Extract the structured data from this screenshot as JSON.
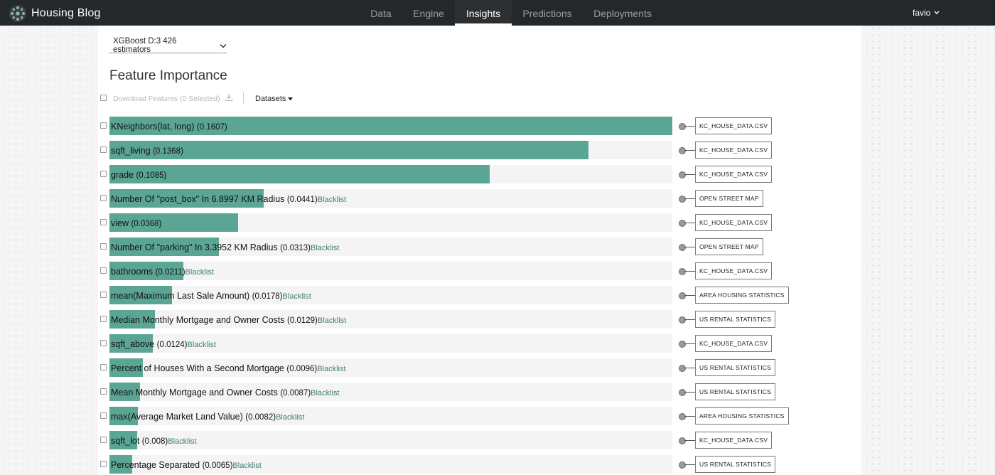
{
  "app": {
    "name": "Housing Blog",
    "user": "favio"
  },
  "nav": {
    "tabs": [
      {
        "label": "Data",
        "active": false
      },
      {
        "label": "Engine",
        "active": false
      },
      {
        "label": "Insights",
        "active": true
      },
      {
        "label": "Predictions",
        "active": false
      },
      {
        "label": "Deployments",
        "active": false
      }
    ]
  },
  "model_select": {
    "value": "XGBoost D:3 426 estimators"
  },
  "page_title": "Feature Importance",
  "toolbar": {
    "download_label": "Download Features (0 Selected)",
    "datasets_label": "Datasets"
  },
  "colors": {
    "bar": "#5ba595",
    "track": "#f4f4f4",
    "topbar": "#24282b",
    "link": "#3f7f72"
  },
  "features": [
    {
      "name": "KNeighbors(lat, long)",
      "value": "(0.1607)",
      "importance": 0.1607,
      "blacklist": "",
      "dataset": "KC_HOUSE_DATA.CSV"
    },
    {
      "name": "sqft_living",
      "value": "(0.1368)",
      "importance": 0.1368,
      "blacklist": "",
      "dataset": "KC_HOUSE_DATA.CSV"
    },
    {
      "name": "grade",
      "value": "(0.1085)",
      "importance": 0.1085,
      "blacklist": "",
      "dataset": "KC_HOUSE_DATA.CSV"
    },
    {
      "name": "Number Of \"post_box\" In 6.8997 KM Radius",
      "value": "(0.0441)",
      "importance": 0.0441,
      "blacklist": "Blacklist",
      "dataset": "OPEN STREET MAP"
    },
    {
      "name": "view",
      "value": "(0.0368)",
      "importance": 0.0368,
      "blacklist": "",
      "dataset": "KC_HOUSE_DATA.CSV"
    },
    {
      "name": "Number Of \"parking\" In 3.3952 KM Radius",
      "value": "(0.0313)",
      "importance": 0.0313,
      "blacklist": "Blacklist",
      "dataset": "OPEN STREET MAP"
    },
    {
      "name": "bathrooms",
      "value": "(0.0211)",
      "importance": 0.0211,
      "blacklist": "Blacklist",
      "dataset": "KC_HOUSE_DATA.CSV"
    },
    {
      "name": "mean(Maximum Last Sale Amount)",
      "value": "(0.0178)",
      "importance": 0.0178,
      "blacklist": "Blacklist",
      "dataset": "AREA HOUSING STATISTICS"
    },
    {
      "name": "Median Monthly Mortgage and Owner Costs",
      "value": "(0.0129)",
      "importance": 0.0129,
      "blacklist": "Blacklist",
      "dataset": "US RENTAL STATISTICS"
    },
    {
      "name": "sqft_above",
      "value": "(0.0124)",
      "importance": 0.0124,
      "blacklist": "Blacklist",
      "dataset": "KC_HOUSE_DATA.CSV"
    },
    {
      "name": "Percent of Houses With a Second Mortgage",
      "value": "(0.0096)",
      "importance": 0.0096,
      "blacklist": "Blacklist",
      "dataset": "US RENTAL STATISTICS"
    },
    {
      "name": "Mean Monthly Mortgage and Owner Costs",
      "value": "(0.0087)",
      "importance": 0.0087,
      "blacklist": "Blacklist",
      "dataset": "US RENTAL STATISTICS"
    },
    {
      "name": "max(Average Market Land Value)",
      "value": "(0.0082)",
      "importance": 0.0082,
      "blacklist": "Blacklist",
      "dataset": "AREA HOUSING STATISTICS"
    },
    {
      "name": "sqft_lot",
      "value": "(0.008)",
      "importance": 0.008,
      "blacklist": "Blacklist",
      "dataset": "KC_HOUSE_DATA.CSV"
    },
    {
      "name": "Percentage Separated",
      "value": "(0.0065)",
      "importance": 0.0065,
      "blacklist": "Blacklist",
      "dataset": "US RENTAL STATISTICS"
    }
  ]
}
